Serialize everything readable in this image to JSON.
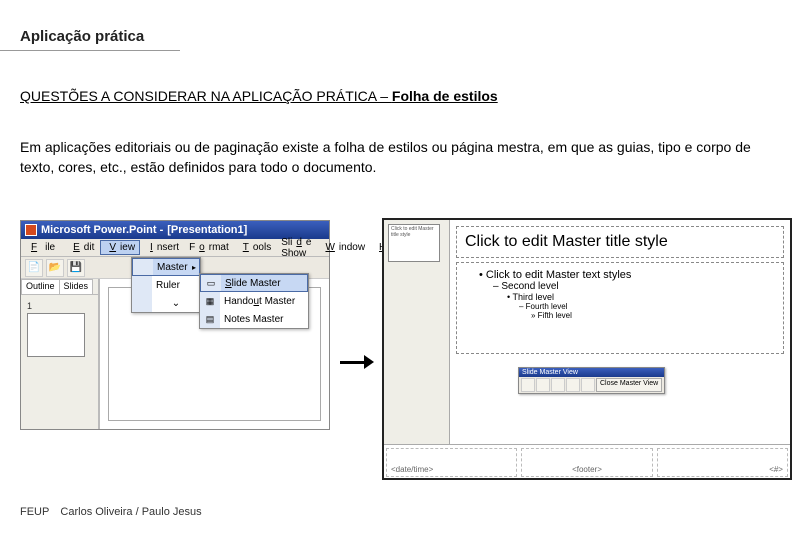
{
  "header": "Aplicação prática",
  "subtitle_prefix": "QUESTÕES A CONSIDERAR NA APLICAÇÃO PRÁTICA – ",
  "subtitle_emph": "Folha de estilos",
  "paragraph": "Em aplicações editoriais ou de paginação existe a folha de estilos ou página mestra, em que as guias, tipo e corpo de texto, cores, etc., estão definidos para todo o documento.",
  "left_app": {
    "title_prefix": "Microsoft Power.Point - ",
    "title_doc": "[Presentation1]",
    "menus": {
      "file": "File",
      "edit": "Edit",
      "view": "View",
      "insert": "Insert",
      "format": "Format",
      "tools": "Tools",
      "slideshow": "Slide Show",
      "window": "Window",
      "help": "H"
    },
    "tabs": {
      "outline": "Outline",
      "slides": "Slides"
    },
    "thumb_number": "1",
    "view_menu": {
      "master": "Master",
      "ruler": "Ruler",
      "expand": "⌄"
    },
    "master_submenu": {
      "slide_master": "Slide Master",
      "handout_master": "Handout Master",
      "notes_master": "Notes Master"
    }
  },
  "right_app": {
    "thumb_title": "Click to edit Master title style",
    "master_title": "Click to edit Master title style",
    "bullets": {
      "l1": "Click to edit Master text styles",
      "l2": "Second level",
      "l3": "Third level",
      "l4": "Fourth level",
      "l5": "Fifth level"
    },
    "floating_title": "Slide Master View",
    "close_button": "Close Master View",
    "footer_left": "<date/time>",
    "footer_center": "<footer>",
    "footer_right": "<#>"
  },
  "footer": {
    "org": "FEUP",
    "authors": "Carlos Oliveira / Paulo Jesus"
  }
}
